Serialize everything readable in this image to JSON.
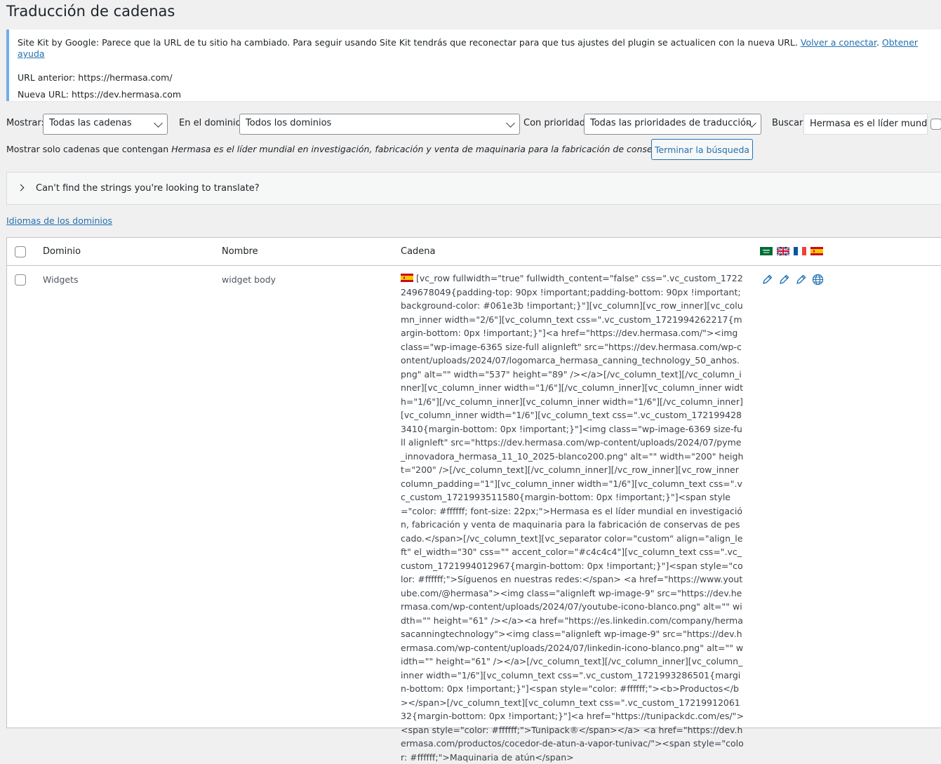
{
  "page": {
    "title": "Traducción de cadenas"
  },
  "notice": {
    "text": "Site Kit by Google: Parece que la URL de tu sitio ha cambiado. Para seguir usando Site Kit tendrás que reconectar para que tus ajustes del plugin se actualicen con la nueva URL.",
    "reconnect_link": "Volver a conectar",
    "help_link": "Obtener ayuda",
    "old_url": "URL anterior: https://hermasa.com/",
    "new_url": "Nueva URL: https://dev.hermasa.com"
  },
  "filters": {
    "show_label": "Mostrar:",
    "show_value": "Todas las cadenas",
    "domain_label": "En el dominio:",
    "domain_value": "Todos los dominios",
    "priority_label": "Con prioridad:",
    "priority_value": "Todas las prioridades de traducción",
    "search_label": "Buscar:",
    "search_value": "Hermasa es el líder mundi"
  },
  "search_info": {
    "prefix": "Mostrar solo cadenas que contengan",
    "term": "Hermasa es el líder mundial en investigación, fabricación y venta de maquinaria para la fabricación de conservas de pescado",
    "end_button": "Terminar la búsqueda"
  },
  "accordion": {
    "label": "Can't find the strings you're looking to translate?"
  },
  "domain_languages_link": "Idiomas de los dominios",
  "table": {
    "headers": {
      "domain": "Dominio",
      "name": "Nombre",
      "string": "Cadena"
    },
    "language_flags": [
      "flag-saudi-arabia",
      "flag-uk",
      "flag-france",
      "flag-spain"
    ],
    "rows": [
      {
        "domain": "Widgets",
        "name": "widget body",
        "source_flag": "flag-spain",
        "string": "[vc_row fullwidth=\"true\" fullwidth_content=\"false\" css=\".vc_custom_1722249678049{padding-top: 90px !important;padding-bottom: 90px !important;background-color: #061e3b !important;}\"][vc_column][vc_row_inner][vc_column_inner width=\"2/6\"][vc_column_text css=\".vc_custom_1721994262217{margin-bottom: 0px !important;}\"]<a href=\"https://dev.hermasa.com/\"><img class=\"wp-image-6365 size-full alignleft\" src=\"https://dev.hermasa.com/wp-content/uploads/2024/07/logomarca_hermasa_canning_technology_50_anhos.png\" alt=\"\" width=\"537\" height=\"89\" /></a>[/vc_column_text][/vc_column_inner][vc_column_inner width=\"1/6\"][/vc_column_inner][vc_column_inner width=\"1/6\"][/vc_column_inner][vc_column_inner width=\"1/6\"][/vc_column_inner][vc_column_inner width=\"1/6\"][vc_column_text css=\".vc_custom_1721994283410{margin-bottom: 0px !important;}\"]<img class=\"wp-image-6369 size-full alignleft\" src=\"https://dev.hermasa.com/wp-content/uploads/2024/07/pyme_innovadora_hermasa_11_10_2025-blanco200.png\" alt=\"\" width=\"200\" height=\"200\" />[/vc_column_text][/vc_column_inner][/vc_row_inner][vc_row_inner column_padding=\"1\"][vc_column_inner width=\"1/6\"][vc_column_text css=\".vc_custom_1721993511580{margin-bottom: 0px !important;}\"]<span style=\"color: #ffffff; font-size: 22px;\">Hermasa es el líder mundial en investigación, fabricación y venta de maquinaria para la fabricación de conservas de pescado.</span>[/vc_column_text][vc_separator color=\"custom\" align=\"align_left\" el_width=\"30\" css=\"\" accent_color=\"#c4c4c4\"][vc_column_text css=\".vc_custom_1721994012967{margin-bottom: 0px !important;}\"]<span style=\"color: #ffffff;\">Síguenos en nuestras redes:</span> <a href=\"https://www.youtube.com/@hermasa\"><img class=\"alignleft wp-image-9\" src=\"https://dev.hermasa.com/wp-content/uploads/2024/07/youtube-icono-blanco.png\" alt=\"\" width=\"\" height=\"61\" /></a><a href=\"https://es.linkedin.com/company/hermasacanningtechnology\"><img class=\"alignleft wp-image-9\" src=\"https://dev.hermasa.com/wp-content/uploads/2024/07/linkedin-icono-blanco.png\" alt=\"\" width=\"\" height=\"61\" /></a>[/vc_column_text][/vc_column_inner][vc_column_inner width=\"1/6\"][vc_column_text css=\".vc_custom_1721993286501{margin-bottom: 0px !important;}\"]<span style=\"color: #ffffff;\"><b>Productos</b></span>[/vc_column_text][vc_column_text css=\".vc_custom_1721991206132{margin-bottom: 0px !important;}\"]<a href=\"https://tunipackdc.com/es/\"><span style=\"color: #ffffff;\">Tunipack®</span></a> <a href=\"https://dev.hermasa.com/productos/cocedor-de-atun-a-vapor-tunivac/\"><span style=\"color: #ffffff;\">Maquinaria de atún</span>"
      }
    ]
  }
}
